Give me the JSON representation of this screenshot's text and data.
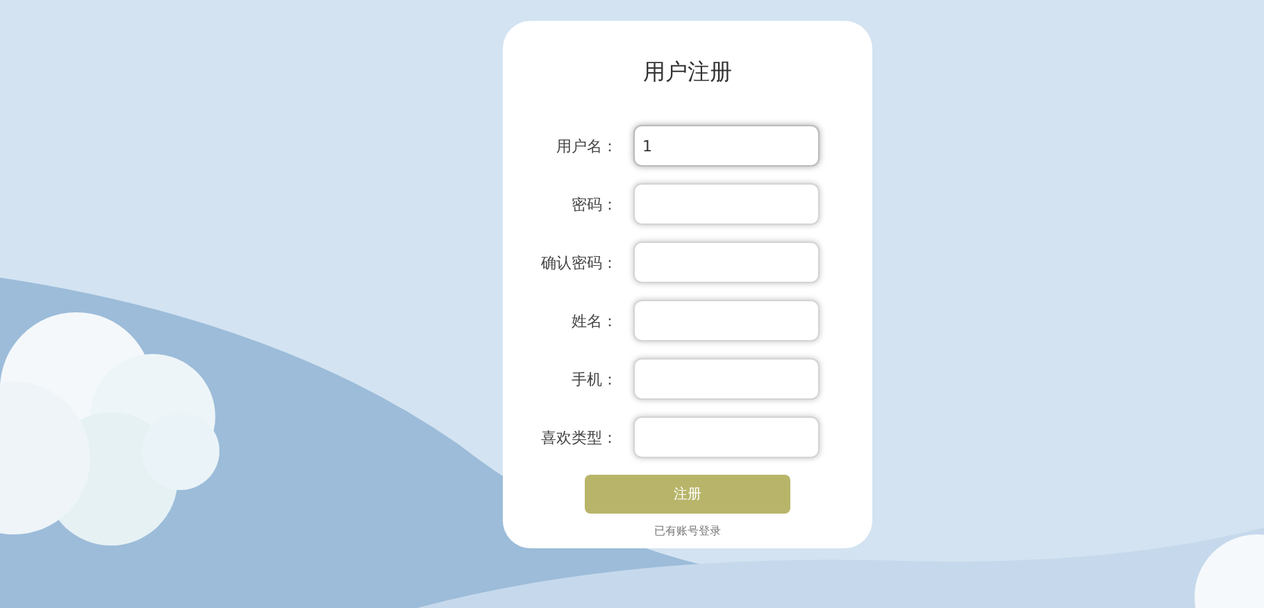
{
  "title": "用户注册",
  "fields": [
    {
      "label": "用户名：",
      "value": "1",
      "focused": true
    },
    {
      "label": "密码：",
      "focused": false
    },
    {
      "label": "确认密码：",
      "focused": false
    },
    {
      "label": "姓名：",
      "focused": false
    },
    {
      "label": "手机：",
      "focused": false
    },
    {
      "label": "喜欢类型：",
      "focused": false
    }
  ],
  "submit_button": "注册",
  "login_link": "已有账号登录"
}
